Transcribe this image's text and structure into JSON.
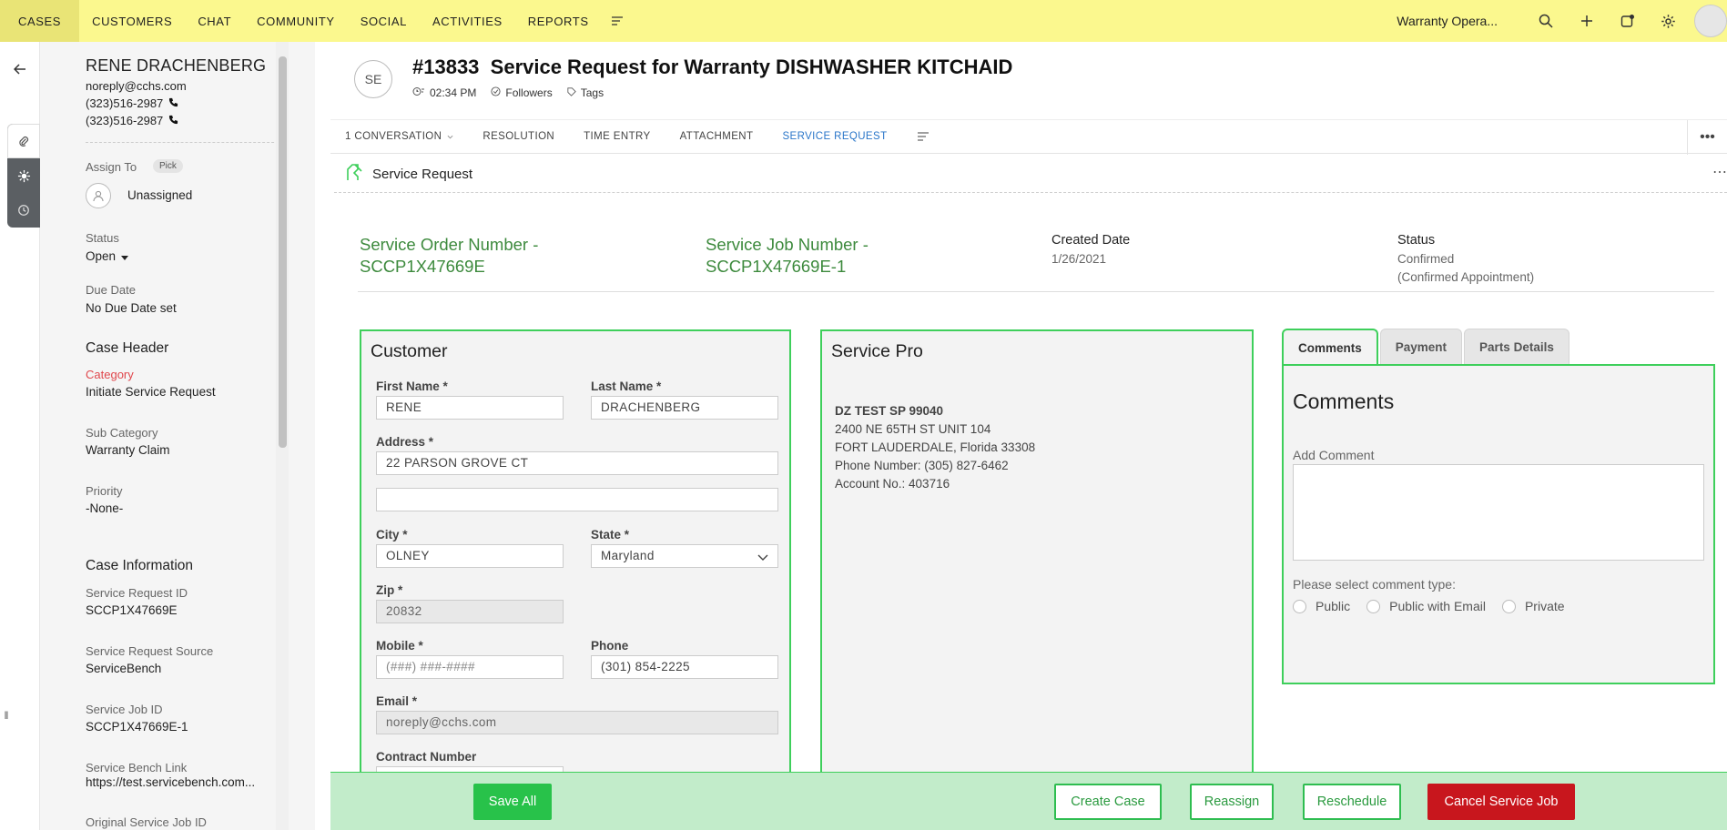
{
  "nav": {
    "tabs": [
      "CASES",
      "CUSTOMERS",
      "CHAT",
      "COMMUNITY",
      "SOCIAL",
      "ACTIVITIES",
      "REPORTS"
    ],
    "active_tab": "CASES",
    "department": "Warranty Opera...",
    "icons": [
      "search-icon",
      "plus-icon",
      "compose-icon",
      "gear-icon"
    ]
  },
  "contact": {
    "name": "RENE DRACHENBERG",
    "email": "noreply@cchs.com",
    "phone1": "(323)516-2987",
    "phone2": "(323)516-2987"
  },
  "properties": {
    "assign_label": "Assign To",
    "pick_label": "Pick",
    "assignee": "Unassigned",
    "status_label": "Status",
    "status_value": "Open",
    "due_label": "Due Date",
    "due_value": "No Due Date set",
    "case_header": "Case Header",
    "category_label": "Category",
    "category_value": "Initiate Service Request",
    "subcategory_label": "Sub Category",
    "subcategory_value": "Warranty Claim",
    "priority_label": "Priority",
    "priority_value": "-None-",
    "case_info": "Case Information",
    "sr_id_label": "Service Request ID",
    "sr_id_value": "SCCP1X47669E",
    "sr_source_label": "Service Request Source",
    "sr_source_value": "ServiceBench",
    "sj_id_label": "Service Job ID",
    "sj_id_value": "SCCP1X47669E-1",
    "sb_link_label": "Service Bench Link",
    "sb_link_value": "https://test.servicebench.com...",
    "orig_sj_label": "Original Service Job ID"
  },
  "ticket": {
    "avatar_initials": "SE",
    "number": "#13833",
    "subject": "Service Request for Warranty DISHWASHER KITCHAID",
    "time": "02:34 PM",
    "followers": "Followers",
    "tags": "Tags"
  },
  "subtabs": {
    "conversation": "1 CONVERSATION",
    "resolution": "RESOLUTION",
    "time_entry": "TIME ENTRY",
    "attachment": "ATTACHMENT",
    "service_request": "SERVICE REQUEST"
  },
  "service_request": {
    "header": "Service Request",
    "order_number_line1": "Service Order Number -",
    "order_number_line2": "SCCP1X47669E",
    "job_number_line1": "Service Job Number -",
    "job_number_line2": "SCCP1X47669E-1",
    "created_label": "Created Date",
    "created_value": "1/26/2021",
    "status_label": "Status",
    "status_line1": "Confirmed",
    "status_line2": "(Confirmed Appointment)"
  },
  "customer": {
    "title": "Customer",
    "first_name_label": "First Name *",
    "first_name": "RENE",
    "last_name_label": "Last Name *",
    "last_name": "DRACHENBERG",
    "address_label": "Address *",
    "address1": "22 PARSON GROVE CT",
    "address2": "",
    "city_label": "City *",
    "city": "OLNEY",
    "state_label": "State *",
    "state": "Maryland",
    "zip_label": "Zip *",
    "zip": "20832",
    "mobile_label": "Mobile *",
    "mobile_placeholder": "(###) ###-####",
    "phone_label": "Phone",
    "phone": "(301) 854-2225",
    "email_label": "Email *",
    "email": "noreply@cchs.com",
    "contract_label": "Contract Number"
  },
  "service_pro": {
    "title": "Service Pro",
    "name": "DZ TEST SP 99040",
    "address": "2400 NE 65TH ST UNIT 104",
    "city_line": "FORT LAUDERDALE, Florida 33308",
    "phone_line": "Phone Number: (305) 827-6462",
    "account_line": "Account No.: 403716"
  },
  "comments": {
    "tabs": [
      "Comments",
      "Payment",
      "Parts Details"
    ],
    "heading": "Comments",
    "add_label": "Add Comment",
    "type_label": "Please select comment type:",
    "types": [
      "Public",
      "Public with Email",
      "Private"
    ]
  },
  "actions": {
    "save_all": "Save All",
    "create_case": "Create Case",
    "reassign": "Reassign",
    "reschedule": "Reschedule",
    "cancel_job": "Cancel Service Job"
  },
  "colors": {
    "nav_bg": "#fbf88e",
    "accent_green": "#3ecf5b",
    "heading_green": "#3d8a3d",
    "active_blue": "#2a76c9",
    "danger_red": "#c8161d",
    "category_red": "#e0474c"
  }
}
